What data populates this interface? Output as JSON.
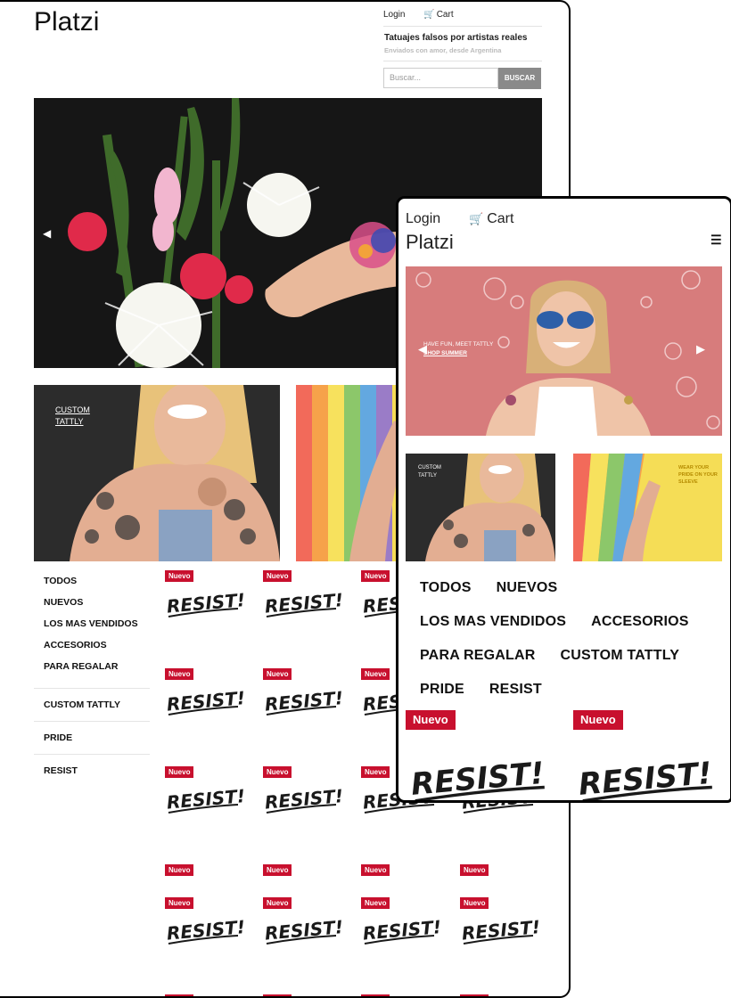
{
  "desktop": {
    "logo": "Platzi",
    "login": "Login",
    "cart": "Cart",
    "tagline": "Tatuajes falsos por artistas reales",
    "tagline_sub": "Enviados con amor, desde Argentina",
    "search_placeholder": "Buscar...",
    "search_button": "BUSCAR",
    "promo1_text": "CUSTOM TATTLY",
    "menu": [
      "TODOS",
      "NUEVOS",
      "LOS MAS VENDIDOS",
      "ACCESORIOS",
      "PARA REGALAR",
      "CUSTOM TATTLY",
      "PRIDE",
      "RESIST"
    ],
    "badge": "Nuevo",
    "product_word": "RESIST!"
  },
  "mobile": {
    "login": "Login",
    "cart": "Cart",
    "logo": "Platzi",
    "hero_text1": "HAVE FUN, MEET TATTLY",
    "hero_text2": "SHOP SUMMER",
    "promo1_text": "CUSTOM TATTLY",
    "promo2_text": "WEAR YOUR PRIDE ON YOUR SLEEVE",
    "nav": [
      "TODOS",
      "NUEVOS",
      "LOS MAS VENDIDOS",
      "ACCESORIOS",
      "PARA REGALAR",
      "CUSTOM TATTLY",
      "PRIDE",
      "RESIST"
    ],
    "badge": "Nuevo",
    "product_word": "RESIST!"
  },
  "icons": {
    "cart": "cart-icon",
    "menu": "hamburger-icon",
    "prev": "chevron-left-icon",
    "next": "chevron-right-icon"
  },
  "colors": {
    "badge": "#c8102e",
    "search_button": "#8a8a8a",
    "frame": "#000000"
  }
}
